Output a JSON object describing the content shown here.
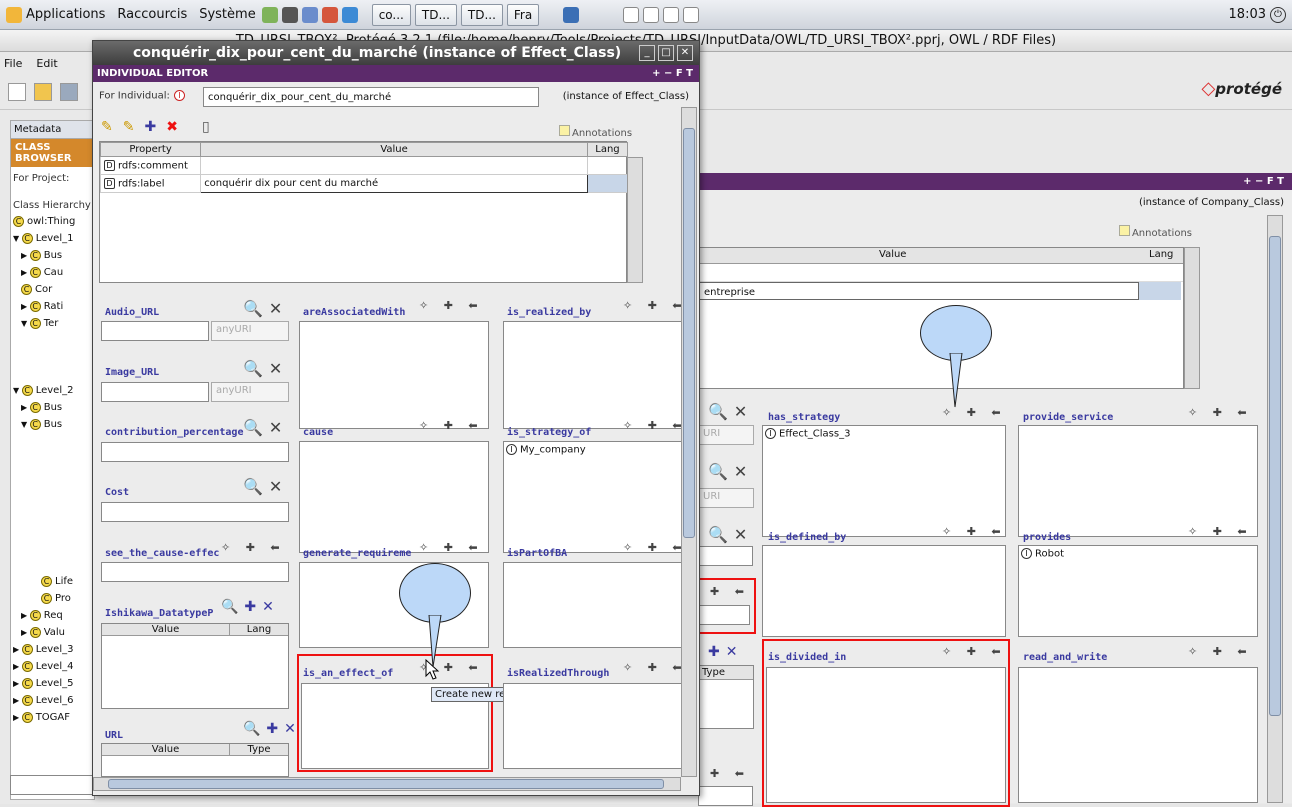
{
  "taskbar": {
    "menus": [
      "Applications",
      "Raccourcis",
      "Système"
    ],
    "tasks": [
      "co...",
      "TD...",
      "TD...",
      "Fra"
    ],
    "clock": "18:03"
  },
  "main": {
    "title": "TD_URSI_TBOX². Protégé 3.2.1     (file:/home/henry/Tools/Projects/TD_URSI/InputData/OWL/TD_URSI_TBOX².pprj, OWL / RDF Files)",
    "menu": [
      "File",
      "Edit"
    ],
    "brand": "protégé",
    "tab_metadata": "Metadata",
    "class_browser": "CLASS BROWSER",
    "for_project": "For Project:",
    "class_hierarchy": "Class Hierarchy",
    "tree": [
      "owl:Thing",
      "Level_1",
      "Bus",
      "Cau",
      "Cor",
      "Rati",
      "Ter",
      "Level_2",
      "Bus",
      "Bus",
      "Life",
      "Pro",
      "Req",
      "Valu",
      "Level_3",
      "Level_4",
      "Level_5",
      "Level_6",
      "TOGAF"
    ],
    "right_instance": "(instance of Company_Class)",
    "annotations": "Annotations",
    "value_header": "Value",
    "lang_header": "Lang",
    "label_value": "entreprise",
    "slots": {
      "has_strategy": "has_strategy",
      "provide_service": "provide_service",
      "is_defined_by": "is_defined_by",
      "provides": "provides",
      "is_divided_in": "is_divided_in",
      "read_and_write": "read_and_write",
      "type_header": "Type",
      "uri_grey": "URI"
    },
    "values": {
      "has_strategy_item": "Effect_Class_3",
      "provides_item": "Robot"
    }
  },
  "dialog": {
    "title": "conquérir_dix_pour_cent_du_marché   (instance of Effect_Class)",
    "header": "INDIVIDUAL EDITOR",
    "header_ctrl": "+ − F T",
    "for_individual": "For Individual:",
    "individual_name": "conquérir_dix_pour_cent_du_marché",
    "instance_of": "(instance of Effect_Class)",
    "annotations": "Annotations",
    "table": {
      "headers": [
        "Property",
        "Value",
        "Lang"
      ],
      "rows": [
        {
          "prop": "rdfs:comment",
          "value": "",
          "lang": ""
        },
        {
          "prop": "rdfs:label",
          "value": "conquérir dix pour cent du marché",
          "lang": ""
        }
      ]
    },
    "slots": {
      "audio_url": "Audio_URL",
      "any_uri": "anyURI",
      "image_url": "Image_URL",
      "contribution": "contribution_percentage",
      "cost": "Cost",
      "see_cause": "see_the_cause-effec",
      "ishikawa": "Ishikawa_DatatypeP",
      "url": "URL",
      "are_associated": "areAssociatedWith",
      "cause": "cause",
      "generate_req": "generate_requireme",
      "is_an_effect_of": "is_an_effect_of",
      "is_realized_by": "is_realized_by",
      "is_strategy_of": "is_strategy_of",
      "is_part_of_ba": "isPartOfBA",
      "is_realized_through": "isRealizedThrough",
      "value_col": "Value",
      "lang_col": "Lang",
      "type_col": "Type"
    },
    "values": {
      "is_strategy_of_item": "My_company"
    },
    "tooltip": "Create new resource..."
  },
  "colors": {
    "purple": "#5c2a6b",
    "orange": "#d4882b",
    "red": "#ee1111",
    "bubble": "#bcd8f8"
  }
}
